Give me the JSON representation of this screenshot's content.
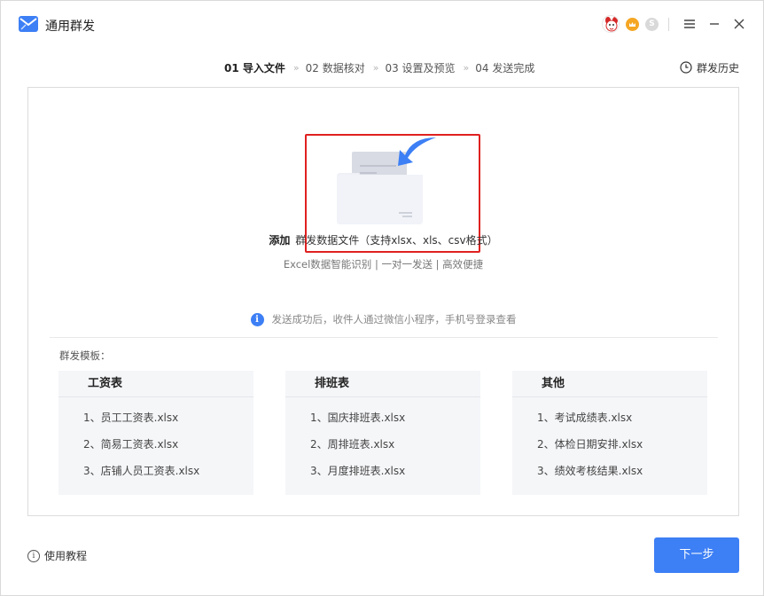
{
  "app": {
    "title": "通用群发",
    "brand_color": "#3d7ff5"
  },
  "titlebar": {
    "icons": [
      "avatar",
      "crown-badge",
      "s-badge",
      "menu-icon",
      "minimize-icon",
      "close-icon"
    ],
    "s_badge_text": "S"
  },
  "steps": [
    {
      "label": "01 导入文件",
      "active": true
    },
    {
      "label": "02 数据核对",
      "active": false
    },
    {
      "label": "03 设置及预览",
      "active": false
    },
    {
      "label": "04 发送完成",
      "active": false
    }
  ],
  "step_separator": "»",
  "history_label": "群发历史",
  "upload": {
    "add_label": "添加",
    "add_desc": "群发数据文件（支持xlsx、xls、csv格式）",
    "sub_text": "Excel数据智能识别 | 一对一发送 | 高效便捷"
  },
  "notice": {
    "icon": "i",
    "text": "发送成功后，收件人通过微信小程序，手机号登录查看"
  },
  "templates": {
    "label": "群发模板：",
    "cards": [
      {
        "title": "工资表",
        "items": [
          "1、员工工资表.xlsx",
          "2、简易工资表.xlsx",
          "3、店铺人员工资表.xlsx"
        ]
      },
      {
        "title": "排班表",
        "items": [
          "1、国庆排班表.xlsx",
          "2、周排班表.xlsx",
          "3、月度排班表.xlsx"
        ]
      },
      {
        "title": "其他",
        "items": [
          "1、考试成绩表.xlsx",
          "2、体检日期安排.xlsx",
          "3、绩效考核结果.xlsx"
        ]
      }
    ]
  },
  "footer": {
    "tutorial_icon": "i",
    "tutorial_label": "使用教程",
    "next_label": "下一步"
  }
}
